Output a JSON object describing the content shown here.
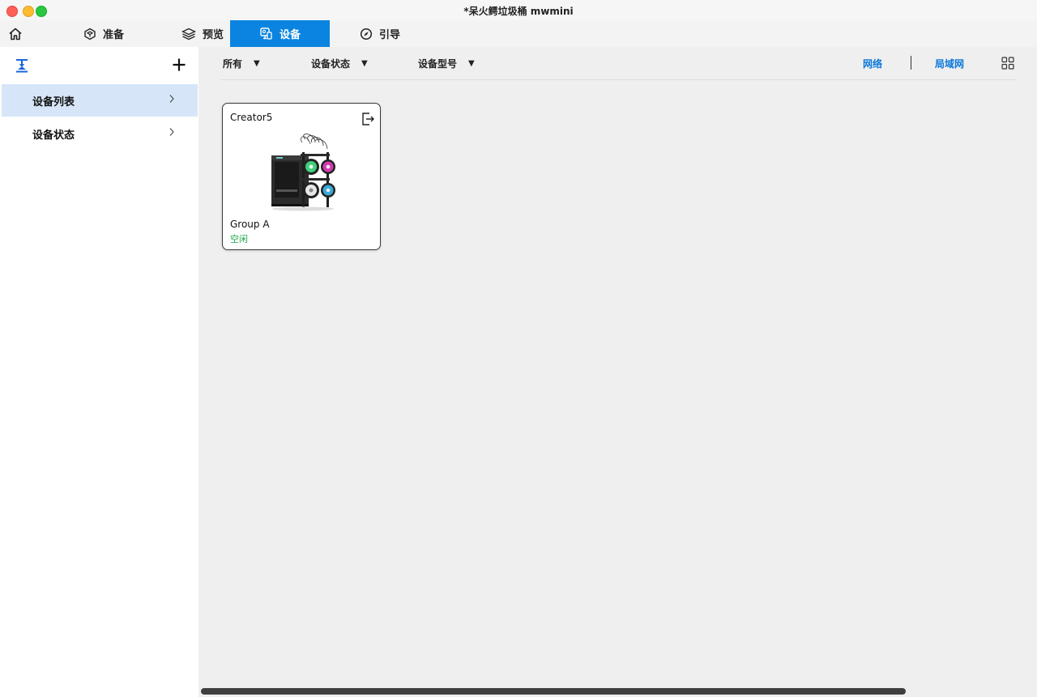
{
  "window": {
    "title": "*呆火鳄垃圾桶 mwmini"
  },
  "tabs": [
    {
      "label": "准备",
      "icon": "prepare-cube-icon"
    },
    {
      "label": "预览",
      "icon": "layers-icon"
    },
    {
      "label": "设备",
      "icon": "device-icon",
      "active": true
    },
    {
      "label": "引导",
      "icon": "compass-icon"
    }
  ],
  "sidebar": {
    "items": [
      {
        "label": "设备列表",
        "selected": true
      },
      {
        "label": "设备状态",
        "selected": false
      }
    ]
  },
  "filters": {
    "all": "所有",
    "status": "设备状态",
    "model": "设备型号",
    "caret": "▼"
  },
  "network": {
    "option_1": "网络",
    "option_2": "局域网"
  },
  "devices": [
    {
      "name": "Creator5",
      "group": "Group A",
      "status": "空闲"
    }
  ],
  "colors": {
    "accent": "#0a84e0",
    "link": "#0a78d8",
    "status_idle": "#1fa84b",
    "selected_row": "#d6e6f8"
  }
}
